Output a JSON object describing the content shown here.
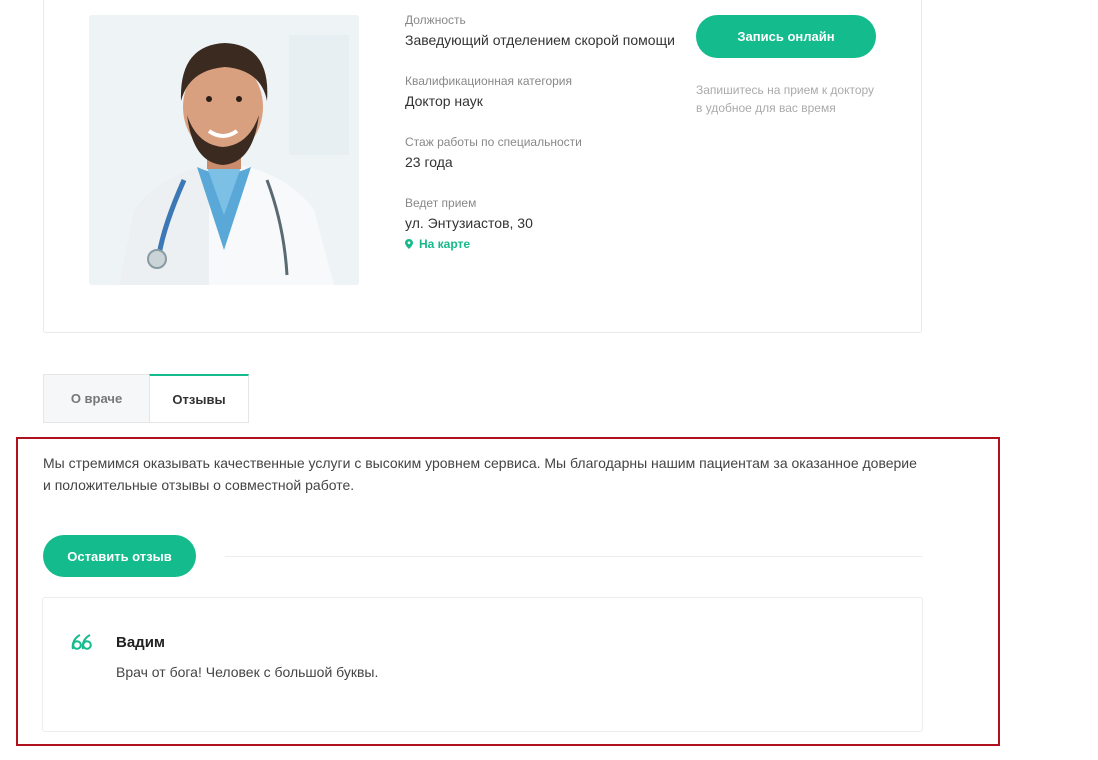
{
  "doctor": {
    "position_label": "Должность",
    "position_value": "Заведующий отделением скорой помощи",
    "category_label": "Квалификационная категория",
    "category_value": "Доктор наук",
    "experience_label": "Стаж работы по специальности",
    "experience_value": "23 года",
    "address_label": "Ведет прием",
    "address_value": "ул. Энтузиастов, 30",
    "map_link": "На карте",
    "photo_icon": "doctor-portrait"
  },
  "booking": {
    "button_label": "Запись онлайн",
    "hint": "Запишитесь на прием к доктору в удобное для вас время"
  },
  "tabs": [
    {
      "label": "О враче",
      "active": false
    },
    {
      "label": "Отзывы",
      "active": true
    }
  ],
  "reviews": {
    "intro": "Мы стремимся оказывать качественные услуги с высоким уровнем сервиса. Мы благодарны нашим пациентам за оказанное доверие и положительные отзывы о совместной работе.",
    "leave_review_label": "Оставить отзыв",
    "items": [
      {
        "author": "Вадим",
        "text": "Врач от бога! Человек с большой буквы.",
        "icon": "quote-icon"
      }
    ]
  },
  "colors": {
    "accent": "#14bb8c",
    "highlight_border": "#b1111c"
  }
}
